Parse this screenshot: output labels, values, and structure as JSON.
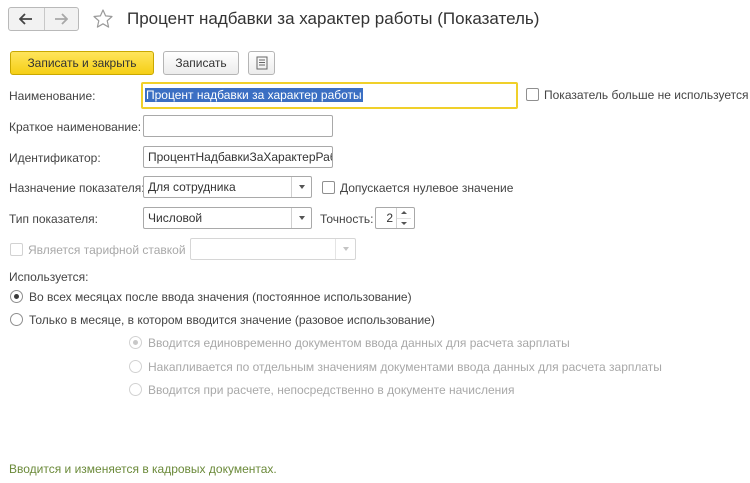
{
  "window": {
    "title": "Процент надбавки за характер работы (Показатель)"
  },
  "toolbar": {
    "save_close_label": "Записать и закрыть",
    "save_label": "Записать",
    "more_icon": "list-icon"
  },
  "form": {
    "name_label": "Наименование:",
    "name_value": "Процент надбавки за характер работы",
    "not_used_label": "Показатель больше не используется",
    "short_name_label": "Краткое наименование:",
    "short_name_value": "",
    "identifier_label": "Идентификатор:",
    "identifier_value": "ПроцентНадбавкиЗаХарактерРабо",
    "purpose_label": "Назначение показателя:",
    "purpose_value": "Для сотрудника",
    "zero_allowed_label": "Допускается нулевое значение",
    "type_label": "Тип показателя:",
    "type_value": "Числовой",
    "precision_label": "Точность:",
    "precision_value": "2",
    "tariff_label": "Является тарифной ставкой",
    "tariff_value": ""
  },
  "usage": {
    "heading": "Используется:",
    "option_permanent": "Во всех месяцах после ввода значения (постоянное использование)",
    "option_once": "Только в месяце, в котором вводится значение (разовое использование)",
    "sub_options": [
      "Вводится единовременно документом ввода данных для расчета зарплаты",
      "Накапливается по отдельным значениям документами ввода данных для расчета зарплаты",
      "Вводится при расчете, непосредственно в документе начисления"
    ]
  },
  "footer": {
    "note": "Вводится и изменяется в кадровых документах."
  },
  "colors": {
    "primary_button": "#f5cf15",
    "focus_border": "#f0d02a",
    "selection": "#3b6fc3",
    "footer_text": "#6b8a3a"
  }
}
